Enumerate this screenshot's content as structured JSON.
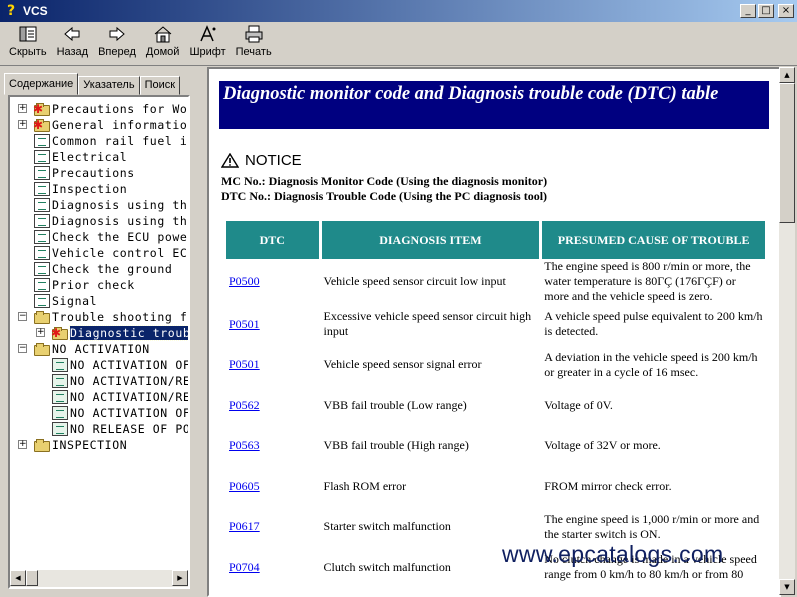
{
  "window": {
    "title": "VCS",
    "app_icon": "question-mark-icon",
    "buttons": [
      "minimize",
      "maximize",
      "close"
    ]
  },
  "toolbar": [
    {
      "label": "Скрыть",
      "icon": "hide-pane-icon"
    },
    {
      "label": "Назад",
      "icon": "back-arrow-icon"
    },
    {
      "label": "Вперед",
      "icon": "forward-arrow-icon"
    },
    {
      "label": "Домой",
      "icon": "home-icon"
    },
    {
      "label": "Шрифт",
      "icon": "font-icon"
    },
    {
      "label": "Печать",
      "icon": "printer-icon"
    }
  ],
  "tabs": {
    "contents": "Содержание",
    "index": "Указатель",
    "search": "Поиск",
    "active": "contents"
  },
  "tree": [
    {
      "label": "Precautions for Wor",
      "icon": "book-star",
      "expander": "+"
    },
    {
      "label": "General information",
      "icon": "book-star",
      "expander": "+"
    },
    {
      "label": "Common rail fuel in",
      "icon": "page"
    },
    {
      "label": "Electrical",
      "icon": "page"
    },
    {
      "label": "Precautions",
      "icon": "page"
    },
    {
      "label": "Inspection",
      "icon": "page"
    },
    {
      "label": "Diagnosis using the",
      "icon": "page"
    },
    {
      "label": "Diagnosis using the",
      "icon": "page"
    },
    {
      "label": "Check the ECU power",
      "icon": "page"
    },
    {
      "label": "Vehicle control ECU",
      "icon": "page"
    },
    {
      "label": "Check the ground",
      "icon": "page"
    },
    {
      "label": "Prior check",
      "icon": "page"
    },
    {
      "label": "Signal",
      "icon": "page"
    },
    {
      "label": "Trouble shooting fl",
      "icon": "folder-open",
      "expander": "-"
    },
    {
      "label": "Diagnostic troub",
      "icon": "folder-star",
      "expander": "+",
      "indent": 1,
      "selected": true
    },
    {
      "label": "NO ACTIVATION",
      "icon": "folder-open",
      "expander": "-"
    },
    {
      "label": "NO ACTIVATION OF",
      "icon": "page-green",
      "indent": 1
    },
    {
      "label": "NO ACTIVATION/RE",
      "icon": "page-green",
      "indent": 1
    },
    {
      "label": "NO ACTIVATION/RE",
      "icon": "page-green",
      "indent": 1
    },
    {
      "label": "NO ACTIVATION OF",
      "icon": "page-green",
      "indent": 1
    },
    {
      "label": "NO RELEASE OF PO",
      "icon": "page-green",
      "indent": 1
    },
    {
      "label": "INSPECTION",
      "icon": "folder",
      "expander": "+"
    }
  ],
  "content": {
    "title": "Diagnostic monitor code and Diagnosis trouble code (DTC) table",
    "notice": "NOTICE",
    "note1": "MC No.: Diagnosis Monitor Code (Using the diagnosis monitor)",
    "note2": "DTC No.: Diagnosis Trouble Code (Using the PC diagnosis tool)",
    "table": {
      "headers": [
        "DTC",
        "DIAGNOSIS ITEM",
        "PRESUMED CAUSE OF TROUBLE"
      ],
      "rows": [
        {
          "dtc": "P0500",
          "item": "Vehicle speed sensor circuit low input",
          "cause": "The engine speed is 800 r/min or more, the water temperature is 80ΓÇ (176ΓÇF) or more and the vehicle speed is zero."
        },
        {
          "dtc": "P0501",
          "item": "Excessive vehicle speed sensor circuit high input",
          "cause": "A vehicle speed pulse equivalent to 200 km/h is detected."
        },
        {
          "dtc": "P0501",
          "item": "Vehicle speed sensor signal error",
          "cause": "A deviation in the vehicle speed is 200 km/h or greater in a cycle of 16 msec."
        },
        {
          "dtc": "P0562",
          "item": "VBB fail trouble (Low range)",
          "cause": "Voltage of 0V."
        },
        {
          "dtc": "P0563",
          "item": "VBB fail trouble (High range)",
          "cause": "Voltage of 32V or more."
        },
        {
          "dtc": "P0605",
          "item": "Flash ROM error",
          "cause": "FROM mirror check error."
        },
        {
          "dtc": "P0617",
          "item": "Starter switch malfunction",
          "cause": "The engine speed is 1,000 r/min or more and the starter switch is ON."
        },
        {
          "dtc": "P0704",
          "item": "Clutch switch malfunction",
          "cause": "No clutch change is made in a vehicle speed range from 0 km/h to 80 km/h or from 80"
        }
      ]
    }
  },
  "watermark": "www.epcatalogs.com",
  "colors": {
    "banner": "#000080",
    "header_cell": "#1f8a8a",
    "link": "#0000ee",
    "selection": "#0a246a"
  }
}
